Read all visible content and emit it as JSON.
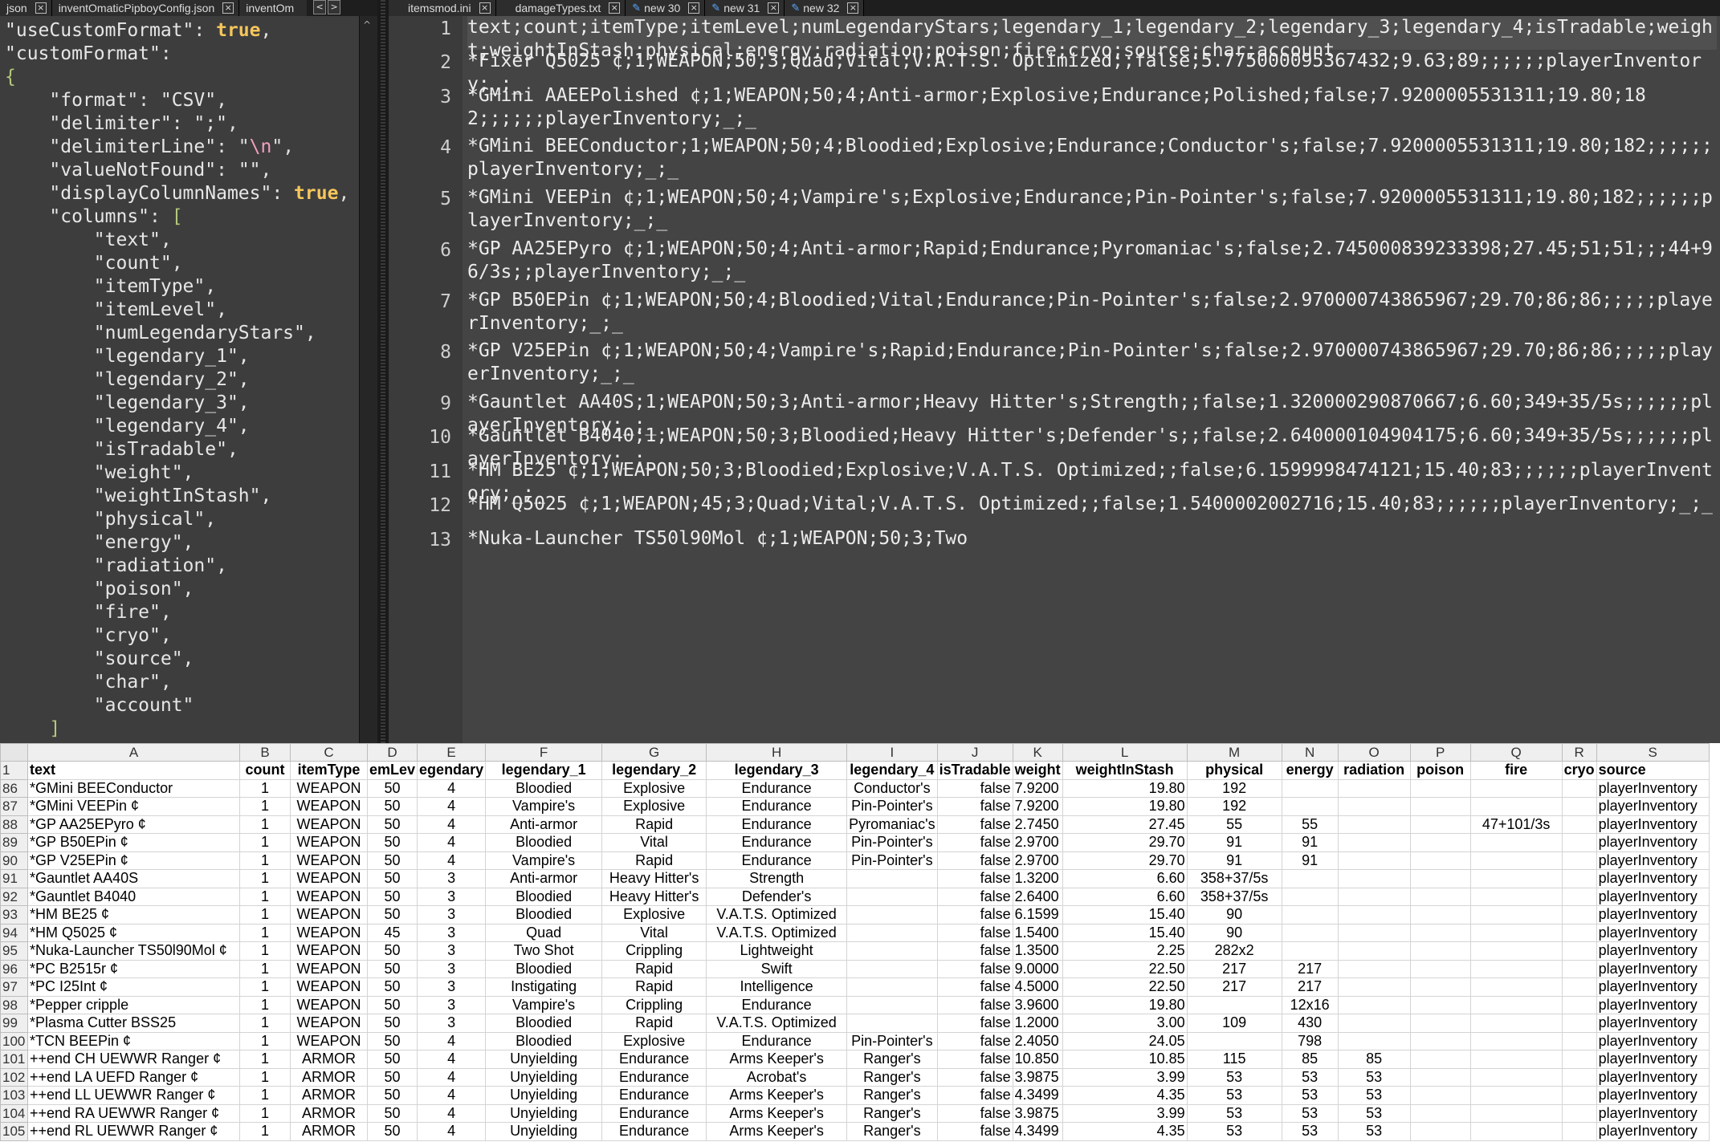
{
  "left_tabs": [
    {
      "label": "json",
      "close": true
    },
    {
      "label": "inventOmaticPipboyConfig.json",
      "close": true
    },
    {
      "label": "inventOm",
      "close": false
    }
  ],
  "right_tabs": [
    {
      "label": "itemsmod.ini",
      "close": true,
      "pencil": false
    },
    {
      "label": "damageTypes.txt",
      "close": true,
      "pencil": false
    },
    {
      "label": "new 30",
      "close": true,
      "pencil": true
    },
    {
      "label": "new 31",
      "close": true,
      "pencil": true
    },
    {
      "label": "new 32",
      "close": true,
      "pencil": true
    }
  ],
  "json_config": {
    "useCustomFormat_key": "\"useCustomFormat\"",
    "useCustomFormat_val": "true",
    "customFormat_key": "\"customFormat\"",
    "format_key": "\"format\"",
    "format_val": "\"CSV\"",
    "delimiter_key": "\"delimiter\"",
    "delimiter_val": "\";\"",
    "delimiterLine_key": "\"delimiterLine\"",
    "delimiterLine_val": "\\n",
    "valueNotFound_key": "\"valueNotFound\"",
    "valueNotFound_val": "\"\"",
    "displayColumnNames_key": "\"displayColumnNames\"",
    "displayColumnNames_val": "true",
    "columns_key": "\"columns\"",
    "columns": [
      "\"text\",",
      "\"count\",",
      "\"itemType\",",
      "\"itemLevel\",",
      "\"numLegendaryStars\",",
      "\"legendary_1\",",
      "\"legendary_2\",",
      "\"legendary_3\",",
      "\"legendary_4\",",
      "\"isTradable\",",
      "\"weight\",",
      "\"weightInStash\",",
      "\"physical\",",
      "\"energy\",",
      "\"radiation\",",
      "\"poison\",",
      "\"fire\",",
      "\"cryo\",",
      "\"source\",",
      "\"char\",",
      "\"account\""
    ],
    "close_bracket": "]"
  },
  "csv_lines": [
    {
      "num": "1",
      "text": "text;count;itemType;itemLevel;numLegendaryStars;legendary_1;legendary_2;legendary_3;legendary_4;isTradable;weight;weightInStash;physical;energy;radiation;poison;fire;cryo;source;char;account"
    },
    {
      "num": "2",
      "text": "*Fixer Q5025 ¢;1;WEAPON;50;3;Quad;Vital;V.A.T.S. Optimized;;false;5.775000095367432;9.63;89;;;;;;playerInventory;_;_"
    },
    {
      "num": "3",
      "text": "*GMini AAEEPolished ¢;1;WEAPON;50;4;Anti-armor;Explosive;Endurance;Polished;false;7.9200005531311;19.80;182;;;;;;playerInventory;_;_"
    },
    {
      "num": "4",
      "text": "*GMini BEEConductor;1;WEAPON;50;4;Bloodied;Explosive;Endurance;Conductor's;false;7.9200005531311;19.80;182;;;;;;playerInventory;_;_"
    },
    {
      "num": "5",
      "text": "*GMini VEEPin ¢;1;WEAPON;50;4;Vampire's;Explosive;Endurance;Pin-Pointer's;false;7.9200005531311;19.80;182;;;;;;playerInventory;_;_"
    },
    {
      "num": "6",
      "text": "*GP AA25EPyro ¢;1;WEAPON;50;4;Anti-armor;Rapid;Endurance;Pyromaniac's;false;2.745000839233398;27.45;51;51;;;44+96/3s;;playerInventory;_;_"
    },
    {
      "num": "7",
      "text": "*GP B50EPin ¢;1;WEAPON;50;4;Bloodied;Vital;Endurance;Pin-Pointer's;false;2.970000743865967;29.70;86;86;;;;;playerInventory;_;_"
    },
    {
      "num": "8",
      "text": "*GP V25EPin ¢;1;WEAPON;50;4;Vampire's;Rapid;Endurance;Pin-Pointer's;false;2.970000743865967;29.70;86;86;;;;;playerInventory;_;_"
    },
    {
      "num": "9",
      "text": "*Gauntlet AA40S;1;WEAPON;50;3;Anti-armor;Heavy Hitter's;Strength;;false;1.320000290870667;6.60;349+35/5s;;;;;;playerInventory;_;_"
    },
    {
      "num": "10",
      "text": "*Gauntlet B4040;1;WEAPON;50;3;Bloodied;Heavy Hitter's;Defender's;;false;2.640000104904175;6.60;349+35/5s;;;;;;playerInventory;_;_"
    },
    {
      "num": "11",
      "text": "*HM BE25 ¢;1;WEAPON;50;3;Bloodied;Explosive;V.A.T.S. Optimized;;false;6.1599998474121;15.40;83;;;;;;playerInventory;_;_"
    },
    {
      "num": "12",
      "text": "*HM Q5025 ¢;1;WEAPON;45;3;Quad;Vital;V.A.T.S. Optimized;;false;1.5400002002716;15.40;83;;;;;;playerInventory;_;_"
    },
    {
      "num": "13",
      "text": "*Nuka-Launcher TS50l90Mol ¢;1;WEAPON;50;3;Two"
    }
  ],
  "sheet": {
    "col_letters": [
      "A",
      "B",
      "C",
      "D",
      "E",
      "F",
      "G",
      "H",
      "I",
      "J",
      "K",
      "L",
      "M",
      "N",
      "O",
      "P",
      "Q",
      "R",
      "S"
    ],
    "header_row_num": "1",
    "headers": [
      "text",
      "count",
      "itemType",
      "emLev",
      "egendary",
      "legendary_1",
      "legendary_2",
      "legendary_3",
      "legendary_4",
      "isTradable",
      "weight",
      "weightInStash",
      "physical",
      "energy",
      "radiation",
      "poison",
      "fire",
      "cryo",
      "source"
    ],
    "rows": [
      {
        "n": "86",
        "c": [
          "*GMini BEEConductor",
          "1",
          "WEAPON",
          "50",
          "4",
          "Bloodied",
          "Explosive",
          "Endurance",
          "Conductor's",
          "false",
          "7.9200",
          "19.80",
          "192",
          "",
          "",
          "",
          "",
          "",
          "playerInventory"
        ]
      },
      {
        "n": "87",
        "c": [
          "*GMini VEEPin ¢",
          "1",
          "WEAPON",
          "50",
          "4",
          "Vampire's",
          "Explosive",
          "Endurance",
          "Pin-Pointer's",
          "false",
          "7.9200",
          "19.80",
          "192",
          "",
          "",
          "",
          "",
          "",
          "playerInventory"
        ]
      },
      {
        "n": "88",
        "c": [
          "*GP AA25EPyro ¢",
          "1",
          "WEAPON",
          "50",
          "4",
          "Anti-armor",
          "Rapid",
          "Endurance",
          "Pyromaniac's",
          "false",
          "2.7450",
          "27.45",
          "55",
          "55",
          "",
          "",
          "47+101/3s",
          "",
          "playerInventory"
        ]
      },
      {
        "n": "89",
        "c": [
          "*GP B50EPin ¢",
          "1",
          "WEAPON",
          "50",
          "4",
          "Bloodied",
          "Vital",
          "Endurance",
          "Pin-Pointer's",
          "false",
          "2.9700",
          "29.70",
          "91",
          "91",
          "",
          "",
          "",
          "",
          "playerInventory"
        ]
      },
      {
        "n": "90",
        "c": [
          "*GP V25EPin ¢",
          "1",
          "WEAPON",
          "50",
          "4",
          "Vampire's",
          "Rapid",
          "Endurance",
          "Pin-Pointer's",
          "false",
          "2.9700",
          "29.70",
          "91",
          "91",
          "",
          "",
          "",
          "",
          "playerInventory"
        ]
      },
      {
        "n": "91",
        "c": [
          "*Gauntlet AA40S",
          "1",
          "WEAPON",
          "50",
          "3",
          "Anti-armor",
          "Heavy Hitter's",
          "Strength",
          "",
          "false",
          "1.3200",
          "6.60",
          "358+37/5s",
          "",
          "",
          "",
          "",
          "",
          "playerInventory"
        ]
      },
      {
        "n": "92",
        "c": [
          "*Gauntlet B4040",
          "1",
          "WEAPON",
          "50",
          "3",
          "Bloodied",
          "Heavy Hitter's",
          "Defender's",
          "",
          "false",
          "2.6400",
          "6.60",
          "358+37/5s",
          "",
          "",
          "",
          "",
          "",
          "playerInventory"
        ]
      },
      {
        "n": "93",
        "c": [
          "*HM BE25 ¢",
          "1",
          "WEAPON",
          "50",
          "3",
          "Bloodied",
          "Explosive",
          "V.A.T.S. Optimized",
          "",
          "false",
          "6.1599",
          "15.40",
          "90",
          "",
          "",
          "",
          "",
          "",
          "playerInventory"
        ]
      },
      {
        "n": "94",
        "c": [
          "*HM Q5025 ¢",
          "1",
          "WEAPON",
          "45",
          "3",
          "Quad",
          "Vital",
          "V.A.T.S. Optimized",
          "",
          "false",
          "1.5400",
          "15.40",
          "90",
          "",
          "",
          "",
          "",
          "",
          "playerInventory"
        ]
      },
      {
        "n": "95",
        "c": [
          "*Nuka-Launcher TS50l90Mol ¢",
          "1",
          "WEAPON",
          "50",
          "3",
          "Two Shot",
          "Crippling",
          "Lightweight",
          "",
          "false",
          "1.3500",
          "2.25",
          "282x2",
          "",
          "",
          "",
          "",
          "",
          "playerInventory"
        ]
      },
      {
        "n": "96",
        "c": [
          "*PC B2515r ¢",
          "1",
          "WEAPON",
          "50",
          "3",
          "Bloodied",
          "Rapid",
          "Swift",
          "",
          "false",
          "9.0000",
          "22.50",
          "217",
          "217",
          "",
          "",
          "",
          "",
          "playerInventory"
        ]
      },
      {
        "n": "97",
        "c": [
          "*PC I25Int ¢",
          "1",
          "WEAPON",
          "50",
          "3",
          "Instigating",
          "Rapid",
          "Intelligence",
          "",
          "false",
          "4.5000",
          "22.50",
          "217",
          "217",
          "",
          "",
          "",
          "",
          "playerInventory"
        ]
      },
      {
        "n": "98",
        "c": [
          "*Pepper cripple",
          "1",
          "WEAPON",
          "50",
          "3",
          "Vampire's",
          "Crippling",
          "Endurance",
          "",
          "false",
          "3.9600",
          "19.80",
          "",
          "12x16",
          "",
          "",
          "",
          "",
          "playerInventory"
        ]
      },
      {
        "n": "99",
        "c": [
          "*Plasma Cutter BSS25",
          "1",
          "WEAPON",
          "50",
          "3",
          "Bloodied",
          "Rapid",
          "V.A.T.S. Optimized",
          "",
          "false",
          "1.2000",
          "3.00",
          "109",
          "430",
          "",
          "",
          "",
          "",
          "playerInventory"
        ]
      },
      {
        "n": "100",
        "c": [
          "*TCN BEEPin ¢",
          "1",
          "WEAPON",
          "50",
          "4",
          "Bloodied",
          "Explosive",
          "Endurance",
          "Pin-Pointer's",
          "false",
          "2.4050",
          "24.05",
          "",
          "798",
          "",
          "",
          "",
          "",
          "playerInventory"
        ]
      },
      {
        "n": "101",
        "c": [
          "++end CH UEWWR Ranger ¢",
          "1",
          "ARMOR",
          "50",
          "4",
          "Unyielding",
          "Endurance",
          "Arms Keeper's",
          "Ranger's",
          "false",
          "10.850",
          "10.85",
          "115",
          "85",
          "85",
          "",
          "",
          "",
          "playerInventory"
        ]
      },
      {
        "n": "102",
        "c": [
          "++end LA UEFD Ranger ¢",
          "1",
          "ARMOR",
          "50",
          "4",
          "Unyielding",
          "Endurance",
          "Acrobat's",
          "Ranger's",
          "false",
          "3.9875",
          "3.99",
          "53",
          "53",
          "53",
          "",
          "",
          "",
          "playerInventory"
        ]
      },
      {
        "n": "103",
        "c": [
          "++end LL UEWWR Ranger ¢",
          "1",
          "ARMOR",
          "50",
          "4",
          "Unyielding",
          "Endurance",
          "Arms Keeper's",
          "Ranger's",
          "false",
          "4.3499",
          "4.35",
          "53",
          "53",
          "53",
          "",
          "",
          "",
          "playerInventory"
        ]
      },
      {
        "n": "104",
        "c": [
          "++end RA UEWWR Ranger ¢",
          "1",
          "ARMOR",
          "50",
          "4",
          "Unyielding",
          "Endurance",
          "Arms Keeper's",
          "Ranger's",
          "false",
          "3.9875",
          "3.99",
          "53",
          "53",
          "53",
          "",
          "",
          "",
          "playerInventory"
        ]
      },
      {
        "n": "105",
        "c": [
          "++end RL UEWWR Ranger ¢",
          "1",
          "ARMOR",
          "50",
          "4",
          "Unyielding",
          "Endurance",
          "Arms Keeper's",
          "Ranger's",
          "false",
          "4.3499",
          "4.35",
          "53",
          "53",
          "53",
          "",
          "",
          "",
          "playerInventory"
        ]
      }
    ]
  }
}
